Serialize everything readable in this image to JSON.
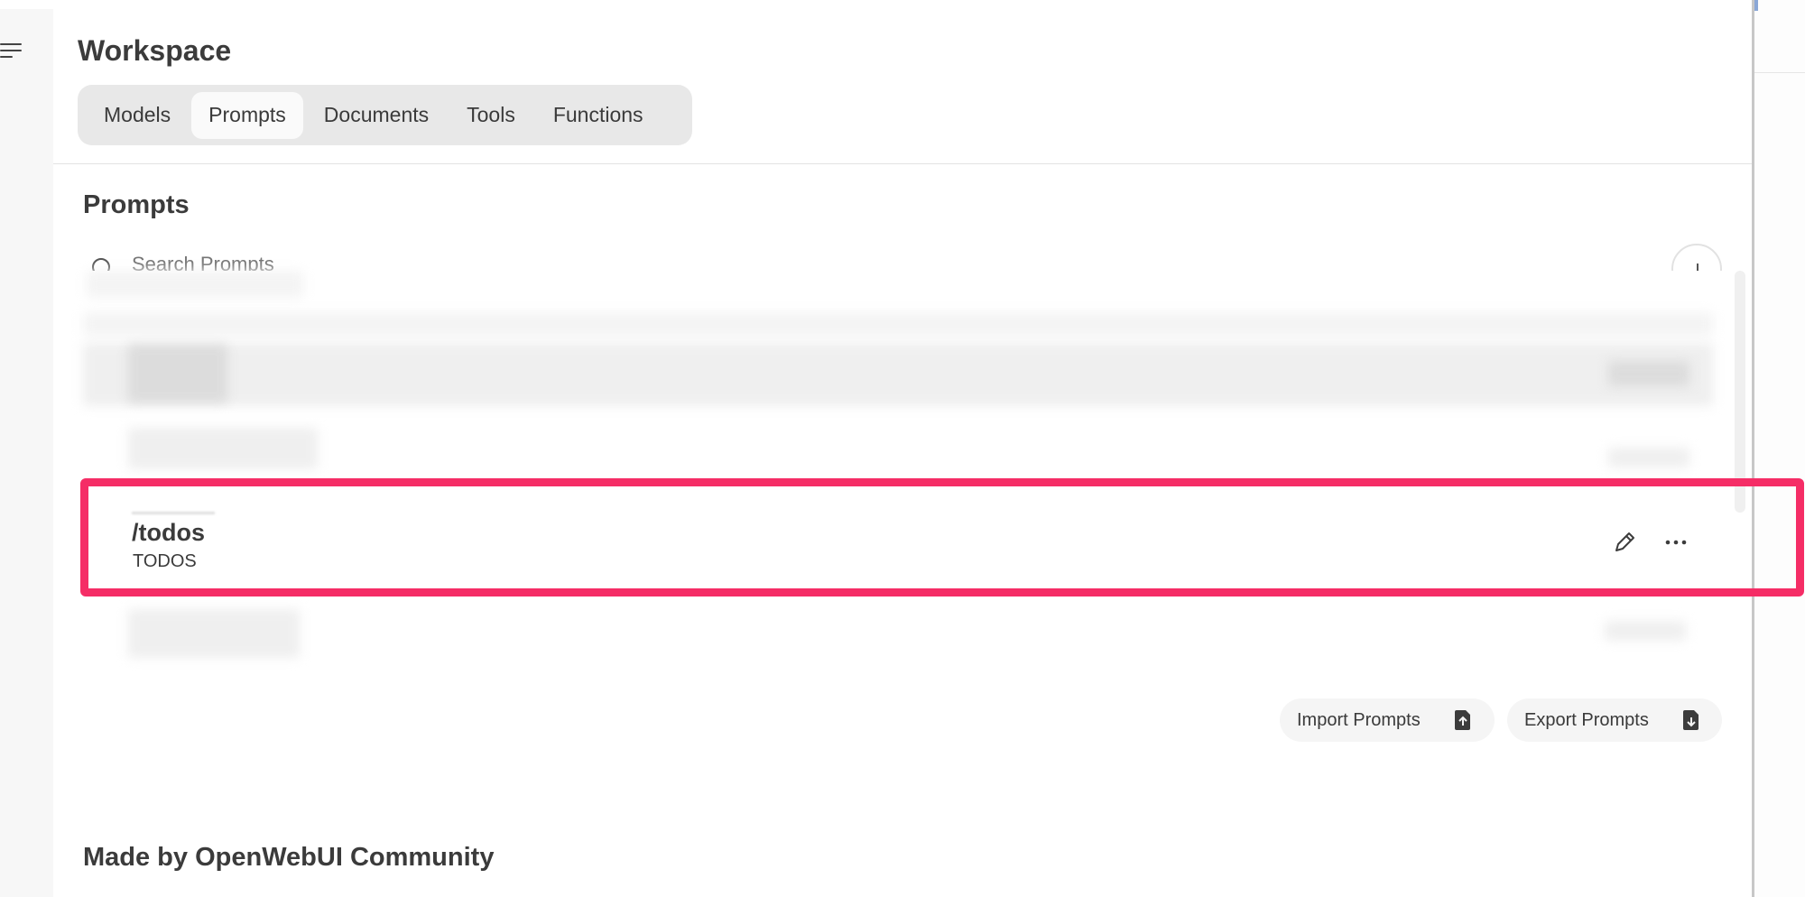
{
  "workspace": {
    "title": "Workspace",
    "tabs": [
      {
        "label": "Models",
        "active": false
      },
      {
        "label": "Prompts",
        "active": true
      },
      {
        "label": "Documents",
        "active": false
      },
      {
        "label": "Tools",
        "active": false
      },
      {
        "label": "Functions",
        "active": false
      }
    ]
  },
  "prompts": {
    "section_title": "Prompts",
    "search": {
      "placeholder": "Search Prompts",
      "value": ""
    },
    "items": [
      {
        "command": "/todos",
        "title": "TODOS",
        "highlighted": true
      }
    ],
    "import_label": "Import Prompts",
    "export_label": "Export Prompts"
  },
  "community": {
    "title": "Made by OpenWebUI Community"
  },
  "colors": {
    "highlight": "#f52d66",
    "tab_active_bg": "#fafafa",
    "tabbar_bg": "#e8e8e8"
  },
  "icons": {
    "menu": "menu-icon",
    "search": "search-icon",
    "add": "plus-icon",
    "edit": "pencil-icon",
    "more": "ellipsis-icon",
    "import": "file-upload-icon",
    "export": "file-download-icon"
  }
}
